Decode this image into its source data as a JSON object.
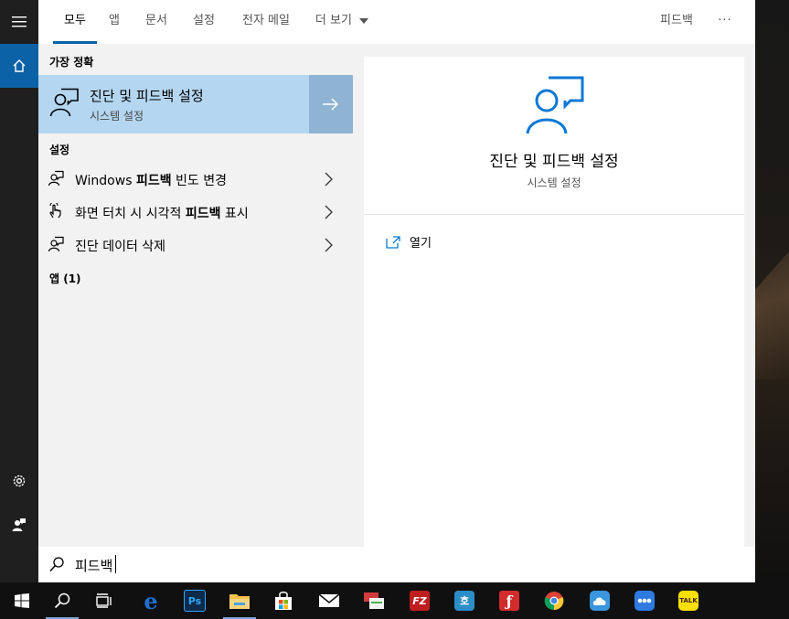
{
  "tabs": [
    {
      "label": "모두"
    },
    {
      "label": "앱"
    },
    {
      "label": "문서"
    },
    {
      "label": "설정"
    },
    {
      "label": "전자 메일"
    },
    {
      "label": "더 보기"
    }
  ],
  "feedback_link": "피드백",
  "more_options": "···",
  "best_match": {
    "heading": "가장 정확",
    "title": "진단 및 피드백 설정",
    "subtitle": "시스템 설정"
  },
  "settings_section": {
    "heading": "설정",
    "items": [
      {
        "label_pre": "Windows ",
        "label_bold": "피드백",
        "label_post": " 빈도 변경"
      },
      {
        "label_pre": "화면 터치 시 시각적 ",
        "label_bold": "피드백",
        "label_post": " 표시"
      },
      {
        "label_pre": "진단 데이터 삭제",
        "label_bold": "",
        "label_post": ""
      }
    ]
  },
  "apps_section": {
    "heading": "앱 (1)"
  },
  "preview": {
    "title": "진단 및 피드백 설정",
    "subtitle": "시스템 설정",
    "open_label": "열기"
  },
  "search": {
    "query": "피드백"
  },
  "taskbar_apps": [
    {
      "name": "edge",
      "label": "e",
      "color": "#1e6fd0"
    },
    {
      "name": "photoshop",
      "label": "Ps",
      "color": "#0d2a48"
    },
    {
      "name": "file-explorer",
      "label": "",
      "color": "#f2c14e"
    },
    {
      "name": "store",
      "label": "",
      "color": "#ffffff"
    },
    {
      "name": "mail",
      "label": "",
      "color": "#ffffff"
    },
    {
      "name": "sticky",
      "label": "",
      "color": "#d23b3b"
    },
    {
      "name": "filezilla",
      "label": "FZ",
      "color": "#bf1e1e"
    },
    {
      "name": "hwp",
      "label": "호",
      "color": "#2c8ec7"
    },
    {
      "name": "acrobat",
      "label": "ƒ",
      "color": "#d22c2c"
    },
    {
      "name": "chrome",
      "label": "",
      "color": "#db4437"
    },
    {
      "name": "onedrive",
      "label": "",
      "color": "#3a96dd"
    },
    {
      "name": "chat",
      "label": "",
      "color": "#2d7be0"
    },
    {
      "name": "kakaotalk",
      "label": "TALK",
      "color": "#f9e000"
    }
  ],
  "colors": {
    "accent": "#0b62a6",
    "selection": "#b4d6f0",
    "icon_blue": "#0b78d4"
  }
}
